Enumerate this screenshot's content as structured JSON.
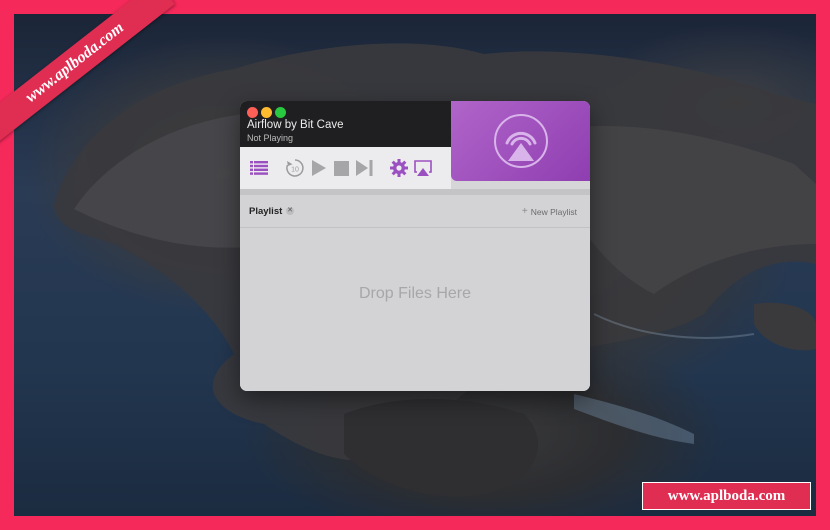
{
  "watermarks": {
    "top_left": "www.aplboda.com",
    "bottom_right": "www.aplboda.com"
  },
  "app": {
    "title": "Airflow by Bit Cave",
    "status": "Not Playing"
  },
  "toolbar": {
    "icons": [
      "playlist-icon",
      "rewind-10-icon",
      "play-icon",
      "stop-icon",
      "next-track-icon",
      "gear-icon",
      "airplay-icon"
    ],
    "rewind_seconds": "10"
  },
  "playlist": {
    "tab_label": "Playlist",
    "new_playlist_label": "New Playlist",
    "empty_hint": "Drop Files Here"
  },
  "colors": {
    "accent": "#9b50c2",
    "artwork_bg": "#9b4dbf",
    "frame": "#f5295a"
  }
}
